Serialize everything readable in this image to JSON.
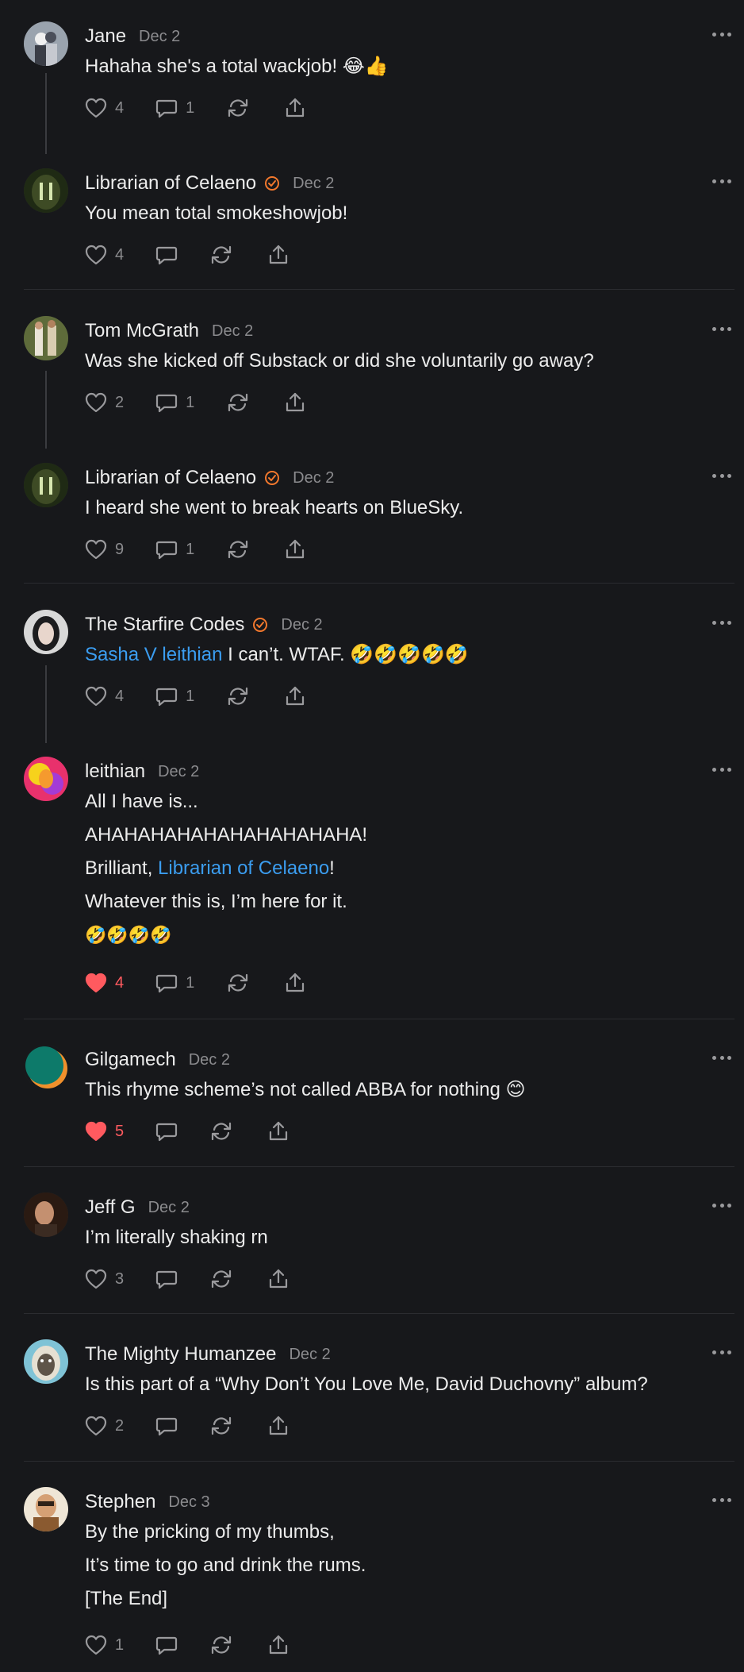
{
  "comments": [
    {
      "name": "Jane",
      "date": "Dec 2",
      "verified": false,
      "lines": [
        "Hahaha she's a total wackjob! 😂👍"
      ],
      "likes": "4",
      "liked": false,
      "replies": "1"
    },
    {
      "name": "Librarian of Celaeno",
      "date": "Dec 2",
      "verified": true,
      "lines": [
        "You mean total smokeshowjob!"
      ],
      "likes": "4",
      "liked": false,
      "replies": ""
    },
    {
      "name": "Tom McGrath",
      "date": "Dec 2",
      "verified": false,
      "lines": [
        "Was she kicked off Substack or did she voluntarily go away?"
      ],
      "likes": "2",
      "liked": false,
      "replies": "1"
    },
    {
      "name": "Librarian of Celaeno",
      "date": "Dec 2",
      "verified": true,
      "lines": [
        "I heard she went to break hearts on BlueSky."
      ],
      "likes": "9",
      "liked": false,
      "replies": "1"
    },
    {
      "name": "The Starfire Codes",
      "date": "Dec 2",
      "verified": true,
      "mention": "Sasha V leithian",
      "lines": [
        " I can’t. WTAF. 🤣🤣🤣🤣🤣"
      ],
      "likes": "4",
      "liked": false,
      "replies": "1"
    },
    {
      "name": "leithian",
      "date": "Dec 2",
      "verified": false,
      "lines": [
        "All I have is...",
        "AHAHAHAHAHAHAHAHAHAHA!",
        "Brilliant, ",
        "Whatever this is, I’m here for it.",
        "🤣🤣🤣🤣"
      ],
      "mention2": "Librarian of Celaeno",
      "mention2_suffix": "!",
      "likes": "4",
      "liked": true,
      "replies": "1"
    },
    {
      "name": "Gilgamech",
      "date": "Dec 2",
      "verified": false,
      "lines": [
        "This rhyme scheme’s not called ABBA for nothing 😊"
      ],
      "likes": "5",
      "liked": true,
      "replies": ""
    },
    {
      "name": "Jeff G",
      "date": "Dec 2",
      "verified": false,
      "lines": [
        "I’m literally shaking rn"
      ],
      "likes": "3",
      "liked": false,
      "replies": ""
    },
    {
      "name": "The Mighty Humanzee",
      "date": "Dec 2",
      "verified": false,
      "lines": [
        "Is this part of a “Why Don’t You Love Me, David Duchovny” album?"
      ],
      "likes": "2",
      "liked": false,
      "replies": ""
    },
    {
      "name": "Stephen",
      "date": "Dec 3",
      "verified": false,
      "lines": [
        "By the pricking of my thumbs,",
        "It’s time to go and drink the rums.",
        "[The End]"
      ],
      "likes": "1",
      "liked": false,
      "replies": ""
    }
  ],
  "colors": {
    "background": "#17181b",
    "link": "#3b9df0",
    "liked": "#ff5a5f",
    "verified": "#f2782d",
    "muted": "#8b8b8e"
  },
  "icons": [
    "heart-icon",
    "comment-icon",
    "restack-icon",
    "share-icon",
    "more-icon",
    "verified-badge-icon"
  ]
}
